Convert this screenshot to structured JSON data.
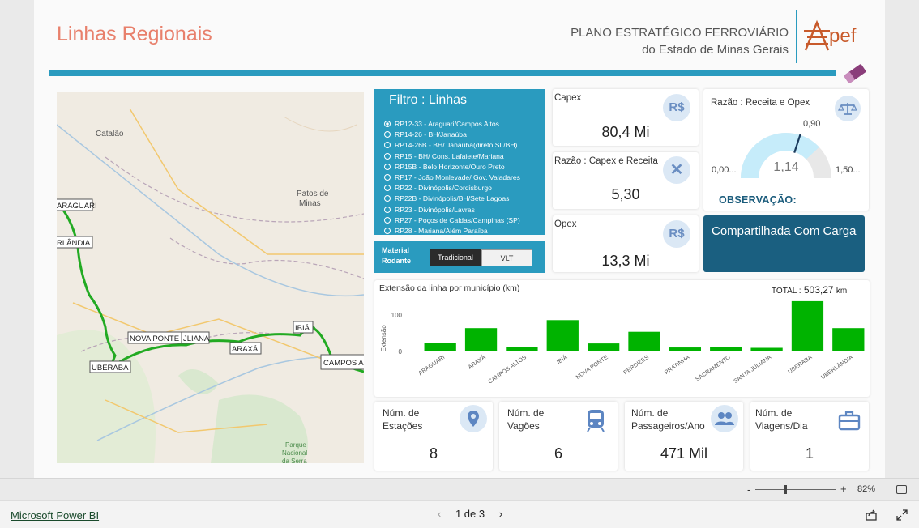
{
  "header": {
    "title": "Linhas Regionais",
    "brand_line1": "PLANO ESTRATÉGICO FERROVIÁRIO",
    "brand_line2": "do Estado de Minas Gerais",
    "logo_text": "pef"
  },
  "map": {
    "place_labels": [
      "Catalão",
      "Patos de Minas",
      "Parque Nacional da Serra"
    ],
    "station_labels": [
      "ARAGUARI",
      "UBERLÂNDIA",
      "NOVA PONTE",
      "SANTA JULIANA",
      "ARAXÁ",
      "IBIÁ",
      "UBERABA",
      "CAMPOS ALTOS"
    ],
    "station_visible": [
      "ARAGUARI",
      "RLÂNDIA",
      "NOVA PONTE",
      "JLIANA",
      "ARAXÁ",
      "IBIÁ",
      "UBERABA",
      "CAMPOS A"
    ],
    "route_color": "#22aa22"
  },
  "filter": {
    "title": "Filtro : Linhas",
    "items": [
      "RP12-33 - Araguari/Campos Altos",
      "RP14-26 - BH/Janaúba",
      "RP14-26B - BH/ Janaúba(direto SL/BH)",
      "RP15 - BH/ Cons. Lafaiete/Mariana",
      "RP15B - Belo Horizonte/Ouro Preto",
      "RP17 - João Monlevade/ Gov. Valadares",
      "RP22 - Divinópolis/Cordisburgo",
      "RP22B - Divinópolis/BH/Sete Lagoas",
      "RP23 - Divinópolis/Lavras",
      "RP27 - Poços de Caldas/Campinas (SP)",
      "RP28 - Mariana/Além Paraíba"
    ],
    "selected_index": 0
  },
  "material": {
    "label_line1": "Material",
    "label_line2": "Rodante",
    "options": [
      "Tradicional",
      "VLT"
    ],
    "selected": "Tradicional"
  },
  "kpis": {
    "capex": {
      "label": "Capex",
      "value": "80,4 Mi",
      "icon_text": "R$",
      "icon": "currency-icon"
    },
    "razao_capex_receita": {
      "label": "Razão : Capex e Receita",
      "value": "5,30",
      "icon_text": "✕",
      "icon": "multiply-icon"
    },
    "opex": {
      "label": "Opex",
      "value": "13,3 Mi",
      "icon_text": "R$",
      "icon": "currency-icon"
    }
  },
  "gauge": {
    "label": "Razão : Receita e Opex",
    "value_text": "1,14",
    "value": 1.14,
    "min_text": "0,00...",
    "max_text": "1,50...",
    "min": 0,
    "max": 1.5,
    "target_text": "0,90",
    "target": 0.9,
    "fill_color": "#c6ecfa",
    "track_color": "#e8e8e8"
  },
  "observacao": {
    "heading": "OBSERVAÇÃO:",
    "text": "Compartilhada Com Carga"
  },
  "chart_data": {
    "type": "bar",
    "title": "Extensão da linha por município (km)",
    "total_label": "TOTAL :",
    "total_value": "503,27",
    "total_unit": "km",
    "ylabel": "Extensão",
    "yticks": [
      0,
      100
    ],
    "ylim": [
      0,
      140
    ],
    "categories": [
      "ARAGUARI",
      "ARAXÁ",
      "CAMPOS ALTOS",
      "IBIÁ",
      "NOVA PONTE",
      "PERDIZES",
      "PRATINHA",
      "SACRAMENTO",
      "SANTA JULIANA",
      "UBERABA",
      "UBERLÂNDIA"
    ],
    "values": [
      24,
      64,
      12,
      86,
      22,
      54,
      11,
      13,
      10,
      138,
      64
    ],
    "color": "#00b300"
  },
  "bottom_kpis": [
    {
      "label_l1": "Núm. de",
      "label_l2": "Estações",
      "value": "8",
      "icon": "location-pin-icon"
    },
    {
      "label_l1": "Núm. de",
      "label_l2": "Vagões",
      "value": "6",
      "icon": "train-icon"
    },
    {
      "label_l1": "Núm. de",
      "label_l2": "Passageiros/Ano",
      "value": "471 Mil",
      "icon": "people-icon"
    },
    {
      "label_l1": "Núm. de",
      "label_l2": "Viagens/Dia",
      "value": "1",
      "icon": "briefcase-icon"
    }
  ],
  "zoom": {
    "minus": "-",
    "plus": "+",
    "level": "82%"
  },
  "footer": {
    "link": "Microsoft Power BI",
    "page_label": "1 de 3"
  }
}
